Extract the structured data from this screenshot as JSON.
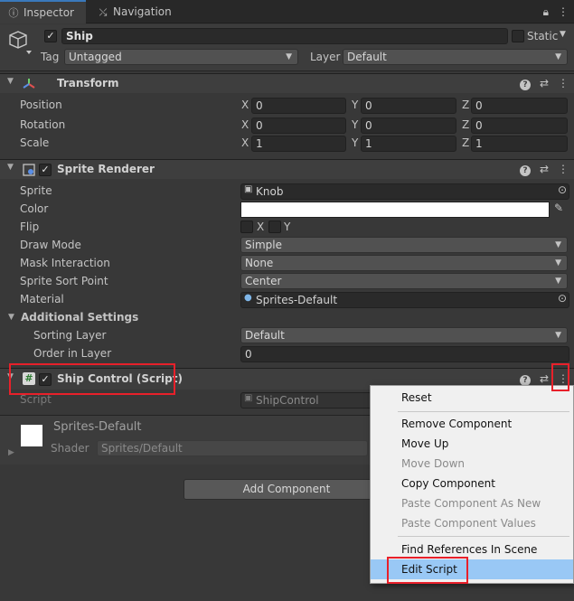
{
  "tabs": [
    {
      "label": "Inspector",
      "icon": "info-icon"
    },
    {
      "label": "Navigation",
      "icon": "navigation-icon"
    }
  ],
  "gameobject": {
    "name": "Ship",
    "active": true,
    "static_label": "Static",
    "tag_label": "Tag",
    "tag_value": "Untagged",
    "layer_label": "Layer",
    "layer_value": "Default"
  },
  "transform": {
    "title": "Transform",
    "rows": [
      {
        "label": "Position",
        "x": "0",
        "y": "0",
        "z": "0"
      },
      {
        "label": "Rotation",
        "x": "0",
        "y": "0",
        "z": "0"
      },
      {
        "label": "Scale",
        "x": "1",
        "y": "1",
        "z": "1"
      }
    ],
    "axis_x": "X",
    "axis_y": "Y",
    "axis_z": "Z"
  },
  "sprite_renderer": {
    "title": "Sprite Renderer",
    "enabled": true,
    "sprite_label": "Sprite",
    "sprite_value": "Knob",
    "color_label": "Color",
    "color_value": "#ffffff",
    "flip_label": "Flip",
    "flip_x": "X",
    "flip_y": "Y",
    "draw_mode_label": "Draw Mode",
    "draw_mode_value": "Simple",
    "mask_label": "Mask Interaction",
    "mask_value": "None",
    "sort_point_label": "Sprite Sort Point",
    "sort_point_value": "Center",
    "material_label": "Material",
    "material_value": "Sprites-Default",
    "additional_label": "Additional Settings",
    "sorting_layer_label": "Sorting Layer",
    "sorting_layer_value": "Default",
    "order_label": "Order in Layer",
    "order_value": "0"
  },
  "ship_control": {
    "title": "Ship Control (Script)",
    "enabled": true,
    "script_label": "Script",
    "script_value": "ShipControl"
  },
  "material_preview": {
    "name": "Sprites-Default",
    "shader_label": "Shader",
    "shader_value": "Sprites/Default"
  },
  "add_component_label": "Add Component",
  "context_menu": {
    "items": [
      {
        "label": "Reset",
        "enabled": true
      },
      {
        "label": "Remove Component",
        "enabled": true
      },
      {
        "label": "Move Up",
        "enabled": true
      },
      {
        "label": "Move Down",
        "enabled": false
      },
      {
        "label": "Copy Component",
        "enabled": true
      },
      {
        "label": "Paste Component As New",
        "enabled": false
      },
      {
        "label": "Paste Component Values",
        "enabled": false
      },
      {
        "label": "Find References In Scene",
        "enabled": true
      },
      {
        "label": "Edit Script",
        "enabled": true,
        "highlighted": true
      }
    ]
  },
  "colors": {
    "highlight_box": "#e8202a",
    "menu_highlight": "#99c8f5",
    "tab_accent": "#3a79bb"
  }
}
